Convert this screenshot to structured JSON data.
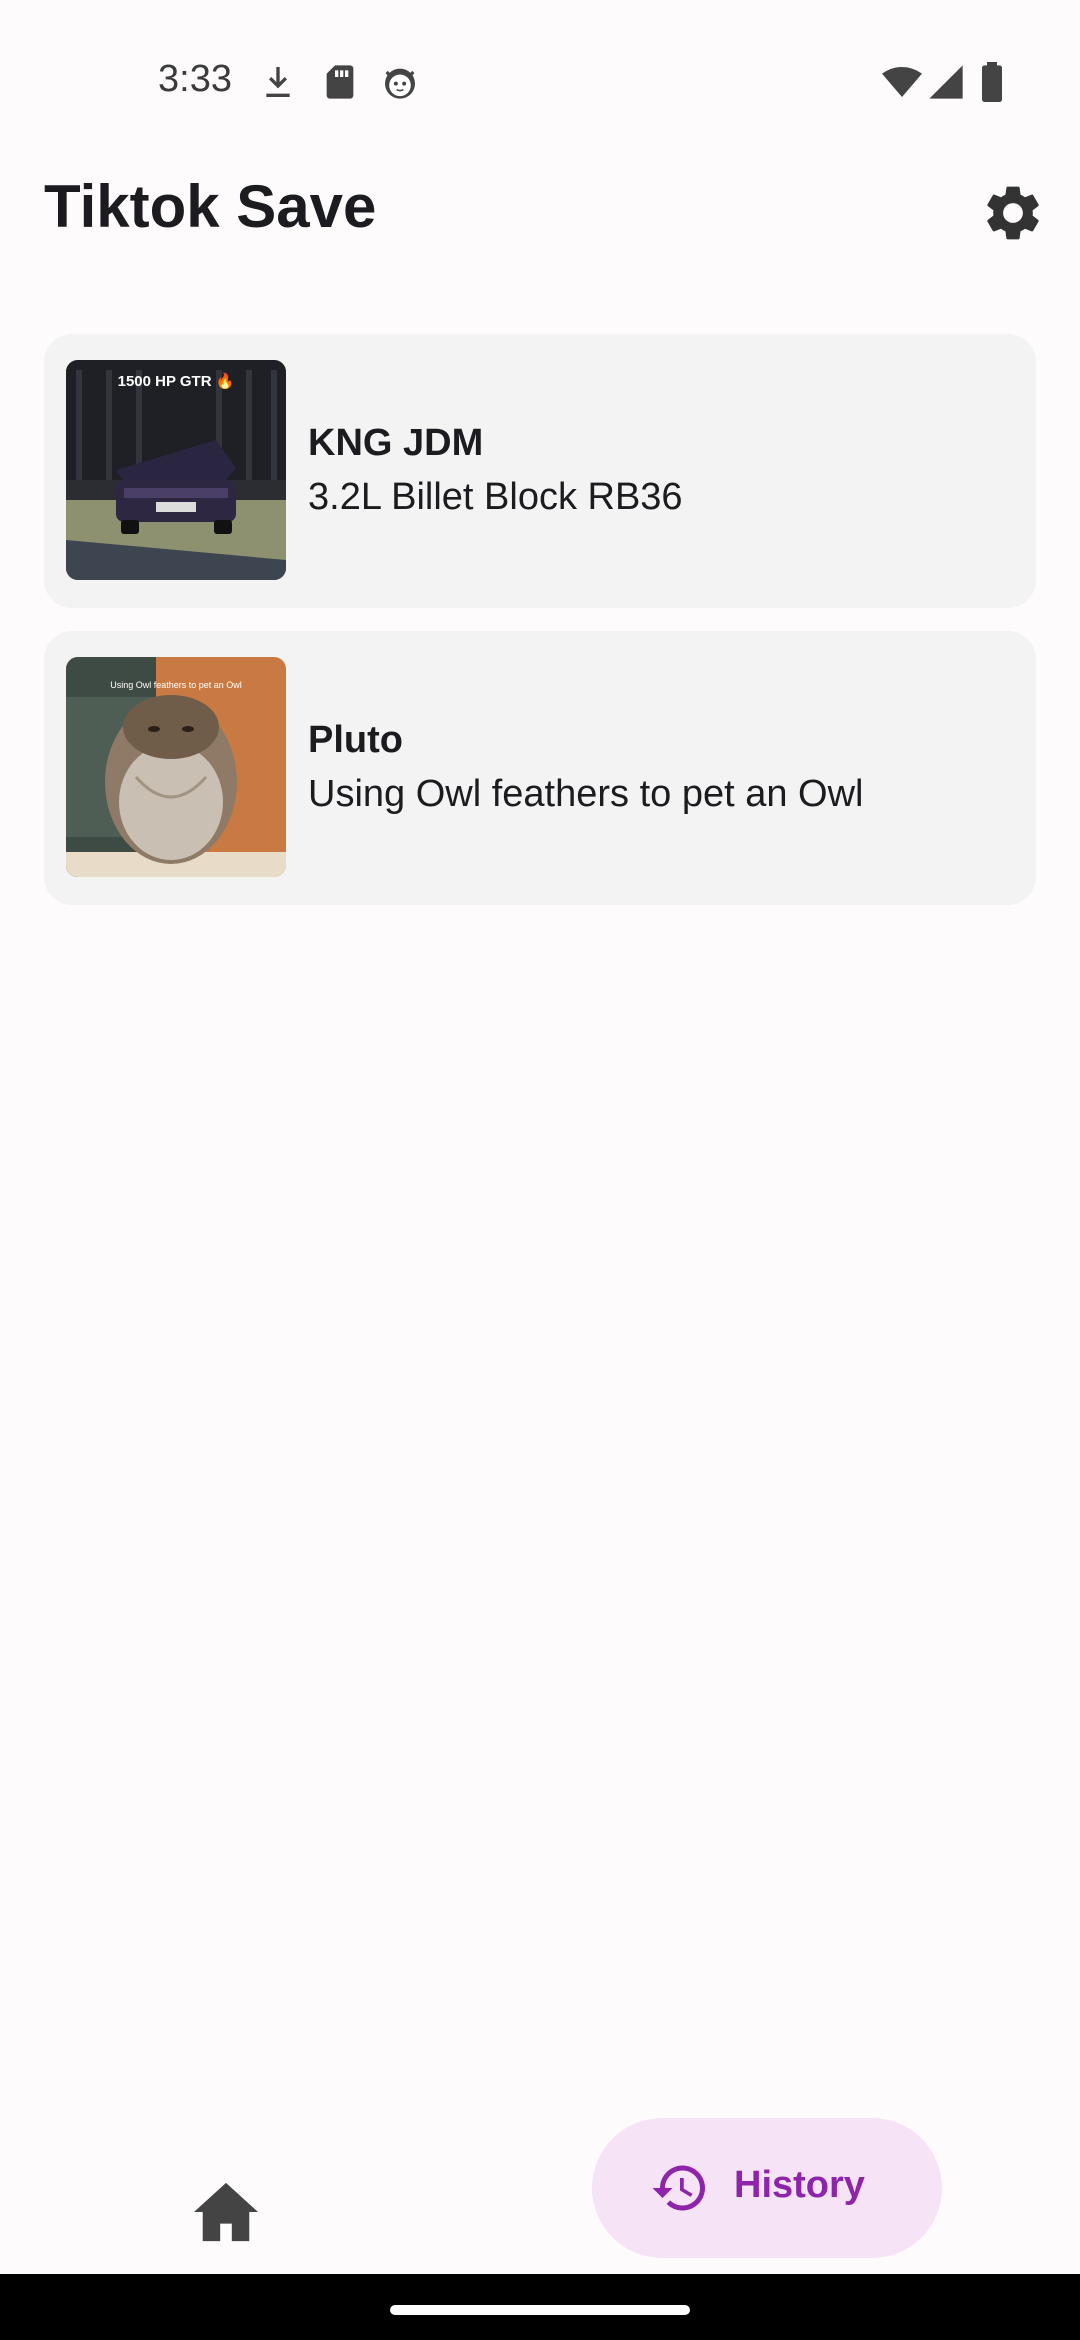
{
  "status_bar": {
    "time": "3:33",
    "icons_left": [
      "download-icon",
      "sd-card-icon",
      "cat-face-icon"
    ],
    "icons_right": [
      "wifi-icon",
      "cell-signal-icon",
      "battery-icon"
    ]
  },
  "app_bar": {
    "title": "Tiktok Save",
    "settings_icon": "gear-icon"
  },
  "videos": [
    {
      "author": "KNG JDM",
      "caption": "3.2L Billet Block RB36",
      "thumb_overlay": "1500 HP GTR 🔥"
    },
    {
      "author": "Pluto",
      "caption": "Using Owl feathers to pet an Owl",
      "thumb_overlay": "Using Owl feathers to pet an Owl"
    }
  ],
  "bottom_nav": {
    "home_icon": "home-icon",
    "history_label": "History",
    "history_icon": "history-icon",
    "accent_color": "#8e24aa"
  }
}
